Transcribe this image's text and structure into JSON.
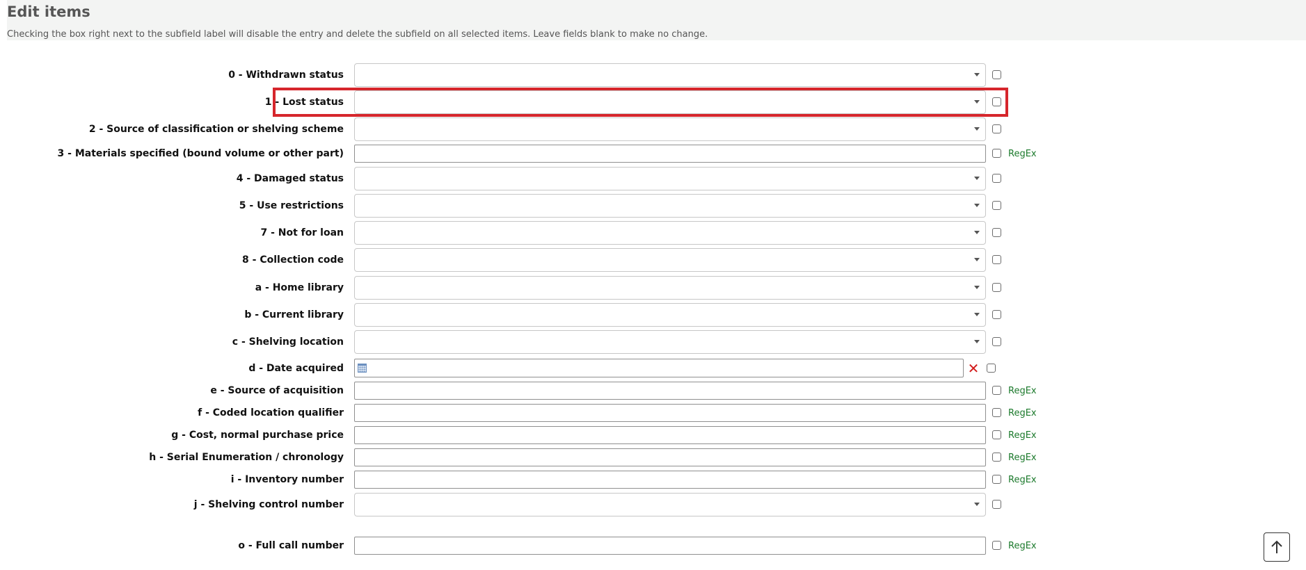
{
  "header": {
    "title": "Edit items",
    "hint": "Checking the box right next to the subfield label will disable the entry and delete the subfield on all selected items. Leave fields blank to make no change."
  },
  "regex_label": "RegEx",
  "clear_symbol": "✕",
  "scroll_top_symbol": "↑",
  "colors": {
    "highlight": "#d6262c",
    "regex_link": "#1c7a2c",
    "clear_icon": "#d21b1b"
  },
  "highlighted_field": "1 - Lost status",
  "fields": [
    {
      "label": "0 - Withdrawn status",
      "type": "select",
      "value": ""
    },
    {
      "label": "1 - Lost status",
      "type": "select",
      "value": ""
    },
    {
      "label": "2 - Source of classification or shelving scheme",
      "type": "select",
      "value": ""
    },
    {
      "label": "3 - Materials specified (bound volume or other part)",
      "type": "text",
      "value": "",
      "regex": true
    },
    {
      "label": "4 - Damaged status",
      "type": "select",
      "value": ""
    },
    {
      "label": "5 - Use restrictions",
      "type": "select",
      "value": ""
    },
    {
      "label": "7 - Not for loan",
      "type": "select",
      "value": ""
    },
    {
      "label": "8 - Collection code",
      "type": "select",
      "value": ""
    },
    {
      "label": "a - Home library",
      "type": "select",
      "value": ""
    },
    {
      "label": "b - Current library",
      "type": "select",
      "value": ""
    },
    {
      "label": "c - Shelving location",
      "type": "select",
      "value": ""
    },
    {
      "label": "d - Date acquired",
      "type": "date",
      "value": "",
      "calendar_icon": "calendar-icon"
    },
    {
      "label": "e - Source of acquisition",
      "type": "text",
      "value": "",
      "regex": true
    },
    {
      "label": "f - Coded location qualifier",
      "type": "text",
      "value": "",
      "regex": true
    },
    {
      "label": "g - Cost, normal purchase price",
      "type": "text",
      "value": "",
      "regex": true
    },
    {
      "label": "h - Serial Enumeration / chronology",
      "type": "text",
      "value": "",
      "regex": true
    },
    {
      "label": "i - Inventory number",
      "type": "text",
      "value": "",
      "regex": true
    },
    {
      "label": "j - Shelving control number",
      "type": "select",
      "value": ""
    },
    {
      "label": "o - Full call number",
      "type": "text",
      "value": "",
      "regex": true
    }
  ]
}
